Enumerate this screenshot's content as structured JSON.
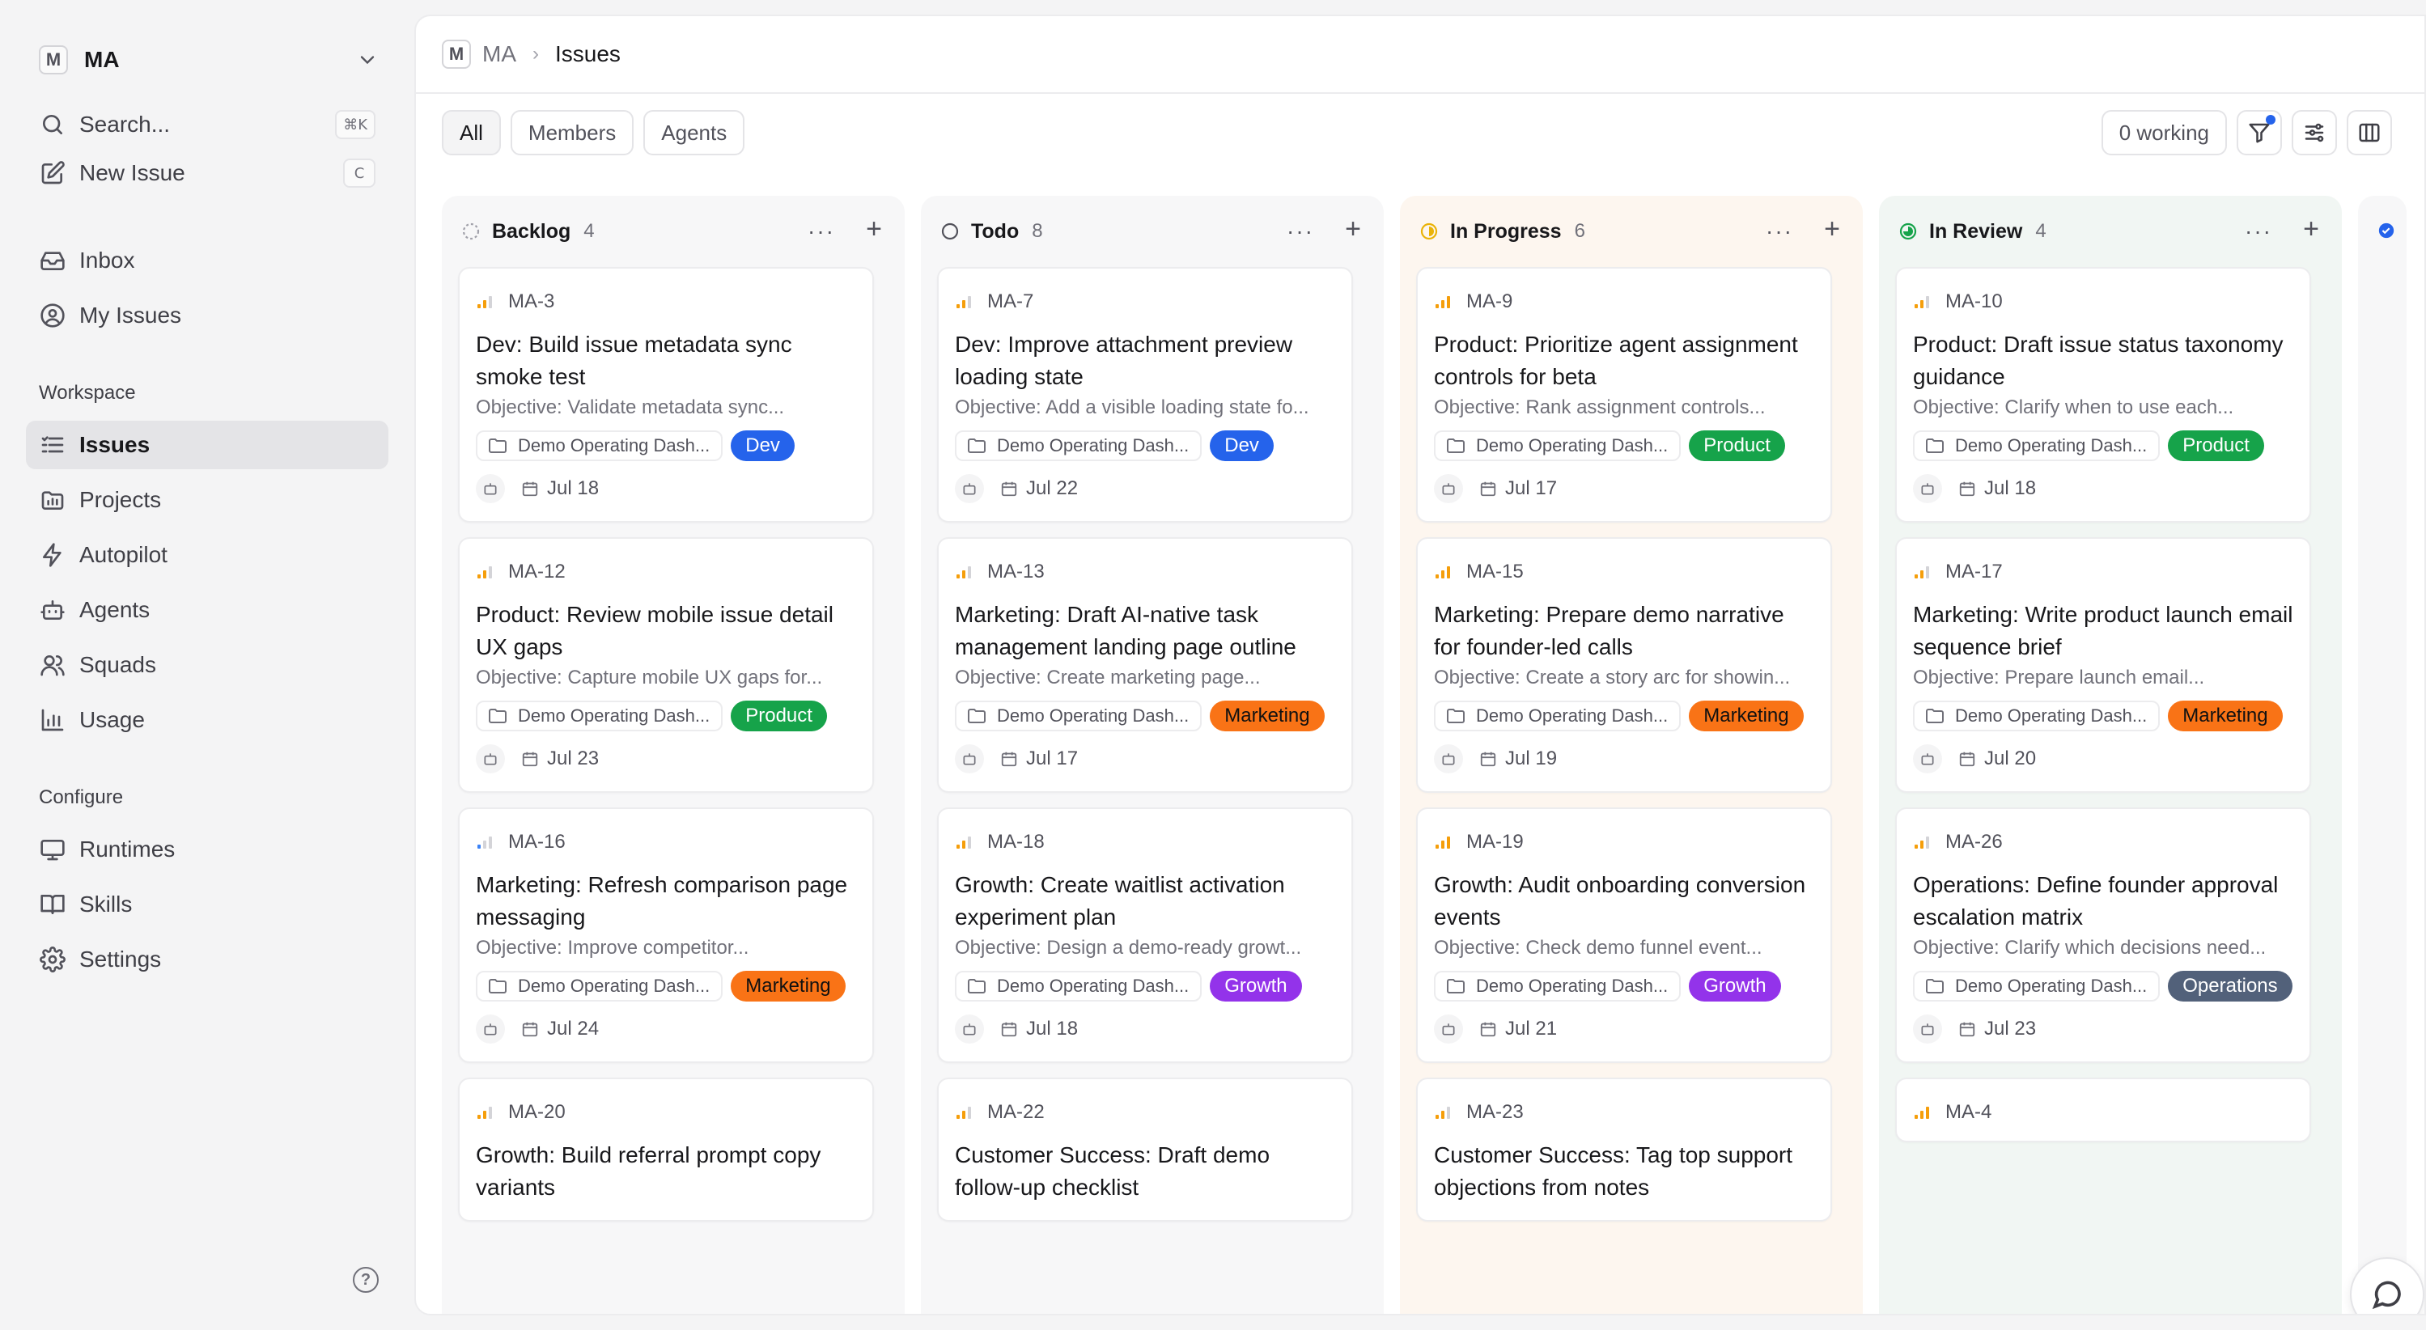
{
  "workspace": {
    "logo": "M",
    "name": "MA"
  },
  "sidebar": {
    "search": {
      "label": "Search...",
      "shortcut": "⌘K"
    },
    "new_issue": {
      "label": "New Issue",
      "shortcut": "C"
    },
    "nav": [
      {
        "label": "Inbox",
        "icon": "inbox-icon"
      },
      {
        "label": "My Issues",
        "icon": "user-circle-icon"
      }
    ],
    "workspace_section": "Workspace",
    "workspace_items": [
      {
        "label": "Issues",
        "icon": "list-icon",
        "active": true
      },
      {
        "label": "Projects",
        "icon": "folder-icon"
      },
      {
        "label": "Autopilot",
        "icon": "bolt-icon"
      },
      {
        "label": "Agents",
        "icon": "robot-icon"
      },
      {
        "label": "Squads",
        "icon": "users-icon"
      },
      {
        "label": "Usage",
        "icon": "chart-icon"
      }
    ],
    "configure_section": "Configure",
    "configure_items": [
      {
        "label": "Runtimes",
        "icon": "monitor-icon"
      },
      {
        "label": "Skills",
        "icon": "book-icon"
      },
      {
        "label": "Settings",
        "icon": "gear-icon"
      }
    ],
    "help": "?"
  },
  "breadcrumb": {
    "logo": "M",
    "workspace": "MA",
    "separator": "›",
    "current": "Issues"
  },
  "filters": {
    "tabs": [
      "All",
      "Members",
      "Agents"
    ],
    "active": "All",
    "working": "0 working"
  },
  "colors": {
    "dev": "#2563eb",
    "product": "#16a34a",
    "marketing": "#f97316",
    "growth": "#9333ea",
    "operations": "#52617a",
    "backlog_bg": "#f7f7f8",
    "todo_bg": "#f7f7f8",
    "in_progress_bg": "#fdf6ef",
    "in_review_bg": "#f1f6f3"
  },
  "columns": [
    {
      "key": "backlog",
      "title": "Backlog",
      "count": "4",
      "more": "···",
      "add": "+",
      "cards": [
        {
          "id": "MA-3",
          "title": "Dev: Build issue metadata sync smoke test",
          "objective": "Objective: Validate metadata sync...",
          "project": "Demo Operating Dash...",
          "label": "Dev",
          "label_class": "dev",
          "due": "Jul 18",
          "priority": "medium"
        },
        {
          "id": "MA-12",
          "title": "Product: Review mobile issue detail UX gaps",
          "objective": "Objective: Capture mobile UX gaps for...",
          "project": "Demo Operating Dash...",
          "label": "Product",
          "label_class": "product",
          "due": "Jul 23",
          "priority": "medium"
        },
        {
          "id": "MA-16",
          "title": "Marketing: Refresh comparison page messaging",
          "objective": "Objective: Improve competitor...",
          "project": "Demo Operating Dash...",
          "label": "Marketing",
          "label_class": "marketing",
          "due": "Jul 24",
          "priority": "low"
        },
        {
          "id": "MA-20",
          "title": "Growth: Build referral prompt copy variants",
          "objective": "",
          "project": "",
          "label": "",
          "label_class": "",
          "due": "",
          "priority": "medium"
        }
      ]
    },
    {
      "key": "todo",
      "title": "Todo",
      "count": "8",
      "more": "···",
      "add": "+",
      "cards": [
        {
          "id": "MA-7",
          "title": "Dev: Improve attachment preview loading state",
          "objective": "Objective: Add a visible loading state fo...",
          "project": "Demo Operating Dash...",
          "label": "Dev",
          "label_class": "dev",
          "due": "Jul 22",
          "priority": "medium"
        },
        {
          "id": "MA-13",
          "title": "Marketing: Draft AI-native task management landing page outline",
          "objective": "Objective: Create marketing page...",
          "project": "Demo Operating Dash...",
          "label": "Marketing",
          "label_class": "marketing",
          "due": "Jul 17",
          "priority": "medium"
        },
        {
          "id": "MA-18",
          "title": "Growth: Create waitlist activation experiment plan",
          "objective": "Objective: Design a demo-ready growt...",
          "project": "Demo Operating Dash...",
          "label": "Growth",
          "label_class": "growth",
          "due": "Jul 18",
          "priority": "medium"
        },
        {
          "id": "MA-22",
          "title": "Customer Success: Draft demo follow-up checklist",
          "objective": "",
          "project": "",
          "label": "",
          "label_class": "",
          "due": "",
          "priority": "medium"
        }
      ]
    },
    {
      "key": "in_progress",
      "title": "In Progress",
      "count": "6",
      "more": "···",
      "add": "+",
      "cards": [
        {
          "id": "MA-9",
          "title": "Product: Prioritize agent assignment controls for beta",
          "objective": "Objective: Rank assignment controls...",
          "project": "Demo Operating Dash...",
          "label": "Product",
          "label_class": "product",
          "due": "Jul 17",
          "priority": "high"
        },
        {
          "id": "MA-15",
          "title": "Marketing: Prepare demo narrative for founder-led calls",
          "objective": "Objective: Create a story arc for showin...",
          "project": "Demo Operating Dash...",
          "label": "Marketing",
          "label_class": "marketing",
          "due": "Jul 19",
          "priority": "high"
        },
        {
          "id": "MA-19",
          "title": "Growth: Audit onboarding conversion events",
          "objective": "Objective: Check demo funnel event...",
          "project": "Demo Operating Dash...",
          "label": "Growth",
          "label_class": "growth",
          "due": "Jul 21",
          "priority": "high"
        },
        {
          "id": "MA-23",
          "title": "Customer Success: Tag top support objections from notes",
          "objective": "",
          "project": "",
          "label": "",
          "label_class": "",
          "due": "",
          "priority": "medium"
        }
      ]
    },
    {
      "key": "in_review",
      "title": "In Review",
      "count": "4",
      "more": "···",
      "add": "+",
      "cards": [
        {
          "id": "MA-10",
          "title": "Product: Draft issue status taxonomy guidance",
          "objective": "Objective: Clarify when to use each...",
          "project": "Demo Operating Dash...",
          "label": "Product",
          "label_class": "product",
          "due": "Jul 18",
          "priority": "medium"
        },
        {
          "id": "MA-17",
          "title": "Marketing: Write product launch email sequence brief",
          "objective": "Objective: Prepare launch email...",
          "project": "Demo Operating Dash...",
          "label": "Marketing",
          "label_class": "marketing",
          "due": "Jul 20",
          "priority": "medium"
        },
        {
          "id": "MA-26",
          "title": "Operations: Define founder approval escalation matrix",
          "objective": "Objective: Clarify which decisions need...",
          "project": "Demo Operating Dash...",
          "label": "Operations",
          "label_class": "operations",
          "due": "Jul 23",
          "priority": "medium"
        },
        {
          "id": "MA-4",
          "title": "",
          "objective": "",
          "project": "",
          "label": "",
          "label_class": "",
          "due": "",
          "priority": "high"
        }
      ]
    }
  ]
}
